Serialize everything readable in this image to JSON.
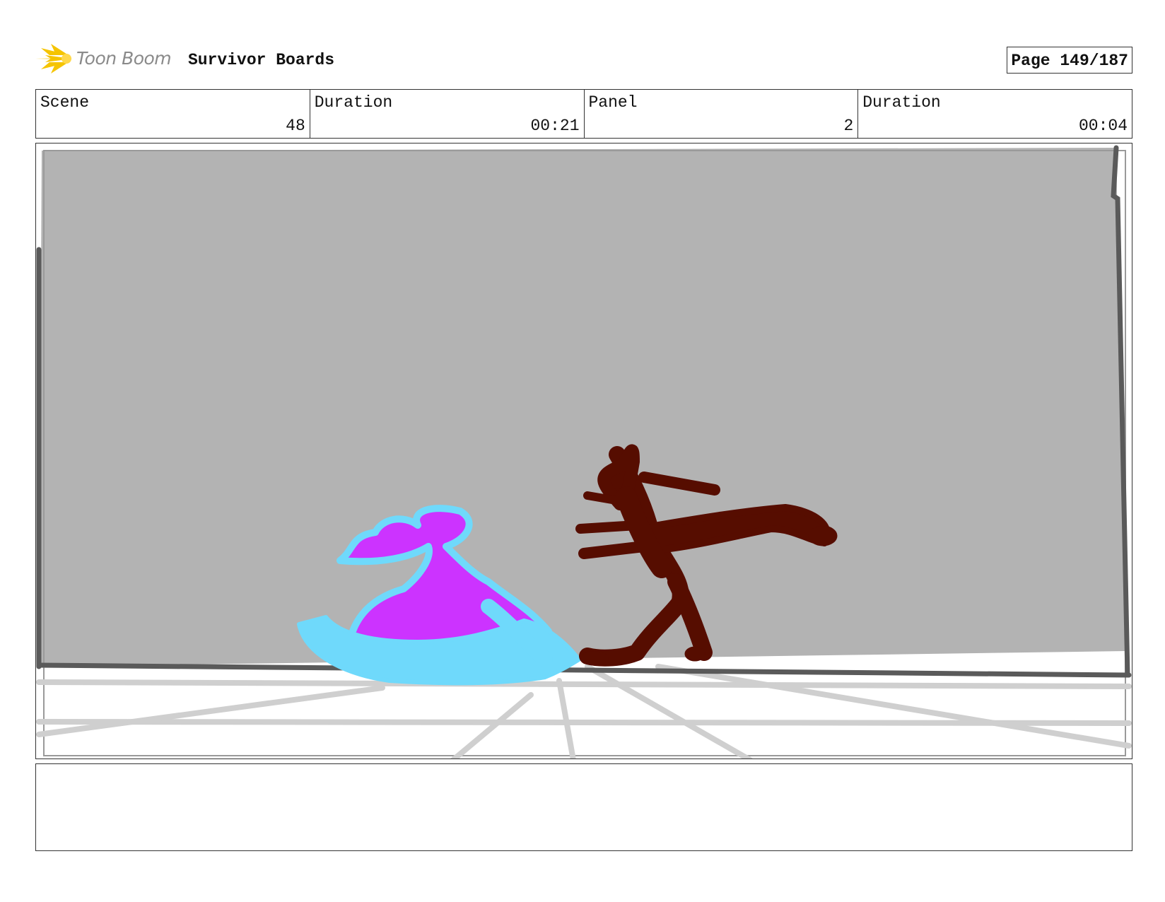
{
  "header": {
    "logo_text": "Toon Boom",
    "project_title": "Survivor Boards",
    "page": "Page 149/187"
  },
  "info": {
    "scene_label": "Scene",
    "scene_value": "48",
    "scene_duration_label": "Duration",
    "scene_duration_value": "00:21",
    "panel_label": "Panel",
    "panel_value": "2",
    "panel_duration_label": "Duration",
    "panel_duration_value": "00:04"
  },
  "caption": {
    "text": ""
  },
  "colors": {
    "wall": "#b3b3b3",
    "floor_lines": "#cfcfcf",
    "figure_left_fill": "#cc33ff",
    "figure_left_outline": "#6fd9fb",
    "figure_right": "#560d00",
    "logo_yellow": "#f5c400"
  }
}
